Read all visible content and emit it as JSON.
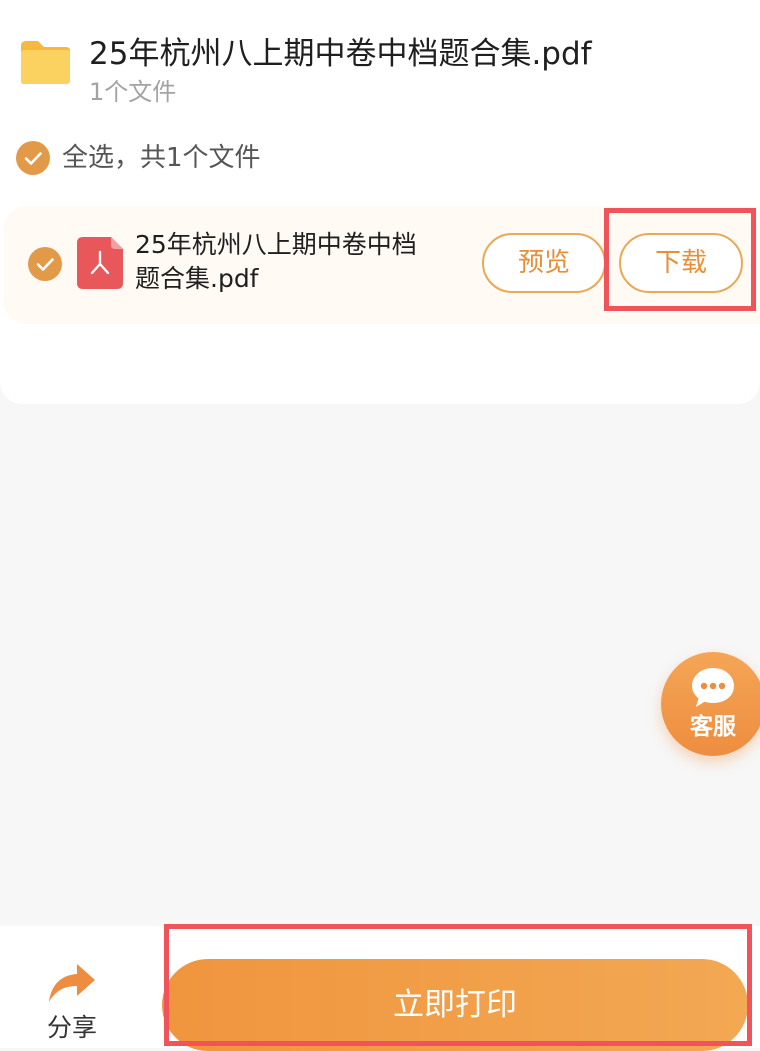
{
  "folder": {
    "title": "25年杭州八上期中卷中档题合集.pdf",
    "count_label": "1个文件",
    "icon": "folder-icon"
  },
  "select_all": {
    "label": "全选，共1个文件",
    "checked": true
  },
  "files": [
    {
      "name": "25年杭州八上期中卷中档题合集.pdf",
      "icon": "pdf-icon",
      "checked": true,
      "preview_label": "预览",
      "download_label": "下载"
    }
  ],
  "service": {
    "label": "客服",
    "icon": "chat-bubble-icon"
  },
  "bottom": {
    "share_label": "分享",
    "share_icon": "share-arrow-icon",
    "print_label": "立即打印"
  },
  "colors": {
    "accent": "#EE8D3F",
    "check": "#E39A48",
    "folder": "#F9C64E",
    "pdf": "#E8575A",
    "highlight": "#F0545A"
  }
}
